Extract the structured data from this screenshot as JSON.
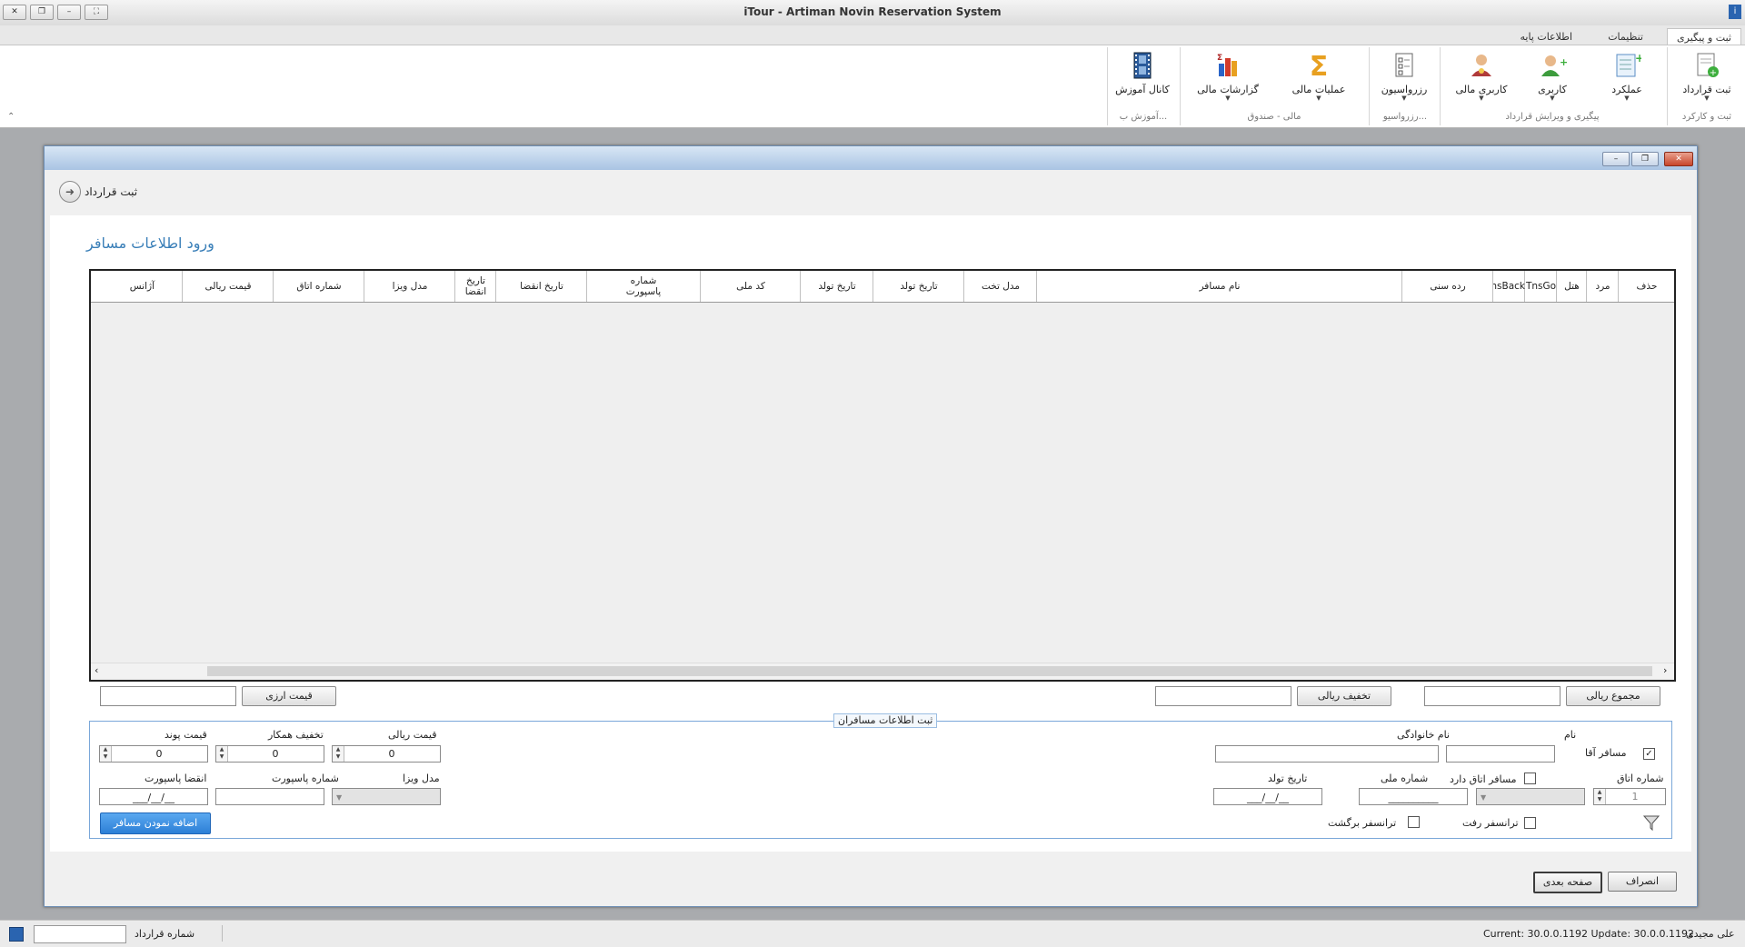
{
  "window": {
    "title": "iTour - Artiman Novin Reservation System",
    "app_icon": "i"
  },
  "ribbon": {
    "tabs": [
      "ثبت و پیگیری",
      "تنظیمات",
      "اطلاعات پایه"
    ],
    "buttons": [
      {
        "label": "ثبت قرارداد",
        "icon": "new-contract-icon"
      },
      {
        "label": "عملکرد",
        "icon": "performance-icon"
      },
      {
        "label": "کاربری",
        "icon": "user-icon"
      },
      {
        "label": "کاربری مالی",
        "icon": "financial-user-icon"
      },
      {
        "label": "رزرواسیون",
        "icon": "reservation-icon"
      },
      {
        "label": "عملیات مالی",
        "icon": "sigma-icon"
      },
      {
        "label": "گزارشات مالی",
        "icon": "bar-chart-icon"
      },
      {
        "label": "کانال آموزش",
        "icon": "film-icon"
      }
    ],
    "groups": [
      "ثبت و کارکرد",
      "پیگیری و ویرایش قرارداد",
      "رزرواسیو...",
      "مالی - صندوق",
      "آموزش ب..."
    ]
  },
  "form": {
    "header": "ثبت قرارداد",
    "title": "ورود اطلاعات مسافر",
    "grid_columns": [
      "حذف",
      "مرد",
      "هتل",
      "TnsGo",
      "TnsBack",
      "رده سنی",
      "نام مسافر",
      "مدل تخت",
      "تاریخ تولد",
      "تاریخ تولد",
      "کد ملی",
      "شماره پاسپورت",
      "تاریخ انقضا",
      "تاریخ انقضا",
      "مدل ویزا",
      "شماره اتاق",
      "قیمت ریالی",
      "آژانس"
    ],
    "totals": {
      "rial_total": "مجموع ریالی",
      "rial_discount": "تخفیف ریالی",
      "currency_price": "قیمت ارزی"
    },
    "fieldset_legend": "ثبت اطلاعات مسافران",
    "fields": {
      "male_passenger": "مسافر آقا",
      "first_name": "نام",
      "last_name": "نام خانوادگی",
      "room_number": "شماره اتاق",
      "room_number_value": "1",
      "has_room": "مسافر اتاق دارد",
      "national_code": "شماره ملی",
      "national_code_mask": "__________",
      "birth_date": "تاریخ تولد",
      "date_mask": "___/__/__",
      "transfer_go": "ترانسفر رفت",
      "transfer_back": "ترانسفر برگشت",
      "rial_price": "قیمت ریالی",
      "partner_discount": "تخفیف همکار",
      "pound_price": "قیمت پوند",
      "spin_value": "0",
      "visa_model": "مدل ویزا",
      "passport_number": "شماره پاسپورت",
      "passport_expiry": "انقضا پاسپورت"
    },
    "add_button": "اضافه نمودن مسافر",
    "cancel_button": "انصراف",
    "next_button": "صفحه بعدی"
  },
  "status": {
    "user": "علی مجیدی",
    "version": "Current: 30.0.0.1192 Update: 30.0.0.1192",
    "contract_number_label": "شماره قرارداد"
  }
}
